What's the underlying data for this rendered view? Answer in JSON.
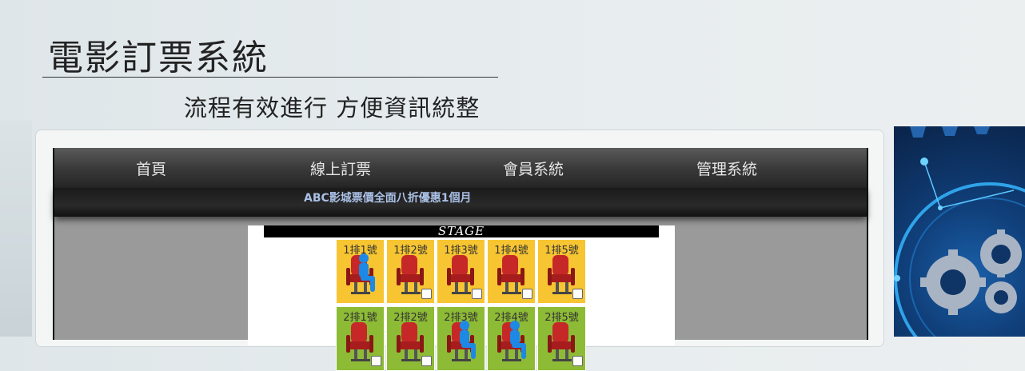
{
  "header": {
    "title": "電影訂票系統",
    "subtitle": "流程有效進行 方便資訊統整"
  },
  "nav": {
    "items": [
      {
        "label": "首頁"
      },
      {
        "label": "線上訂票"
      },
      {
        "label": "會員系統"
      },
      {
        "label": "管理系統"
      }
    ]
  },
  "announcement": "ABC影城票價全面八折優惠1個月",
  "seat_map": {
    "stage_label": "STAGE",
    "rows": [
      {
        "seats": [
          {
            "label": "1排1號",
            "occupied": true
          },
          {
            "label": "1排2號",
            "occupied": false
          },
          {
            "label": "1排3號",
            "occupied": false
          },
          {
            "label": "1排4號",
            "occupied": false
          },
          {
            "label": "1排5號",
            "occupied": false
          }
        ]
      },
      {
        "seats": [
          {
            "label": "2排1號",
            "occupied": false
          },
          {
            "label": "2排2號",
            "occupied": false
          },
          {
            "label": "2排3號",
            "occupied": true
          },
          {
            "label": "2排4號",
            "occupied": true
          },
          {
            "label": "2排5號",
            "occupied": false
          }
        ]
      }
    ]
  },
  "colors": {
    "row1_bg": "#f7c531",
    "row2_bg": "#8dbb35",
    "seat_chair": "#c62828",
    "person": "#1e88e5"
  },
  "icons": {
    "seat": "theater-seat-icon",
    "person": "seated-person-icon",
    "decoration": "gears-graphic"
  }
}
